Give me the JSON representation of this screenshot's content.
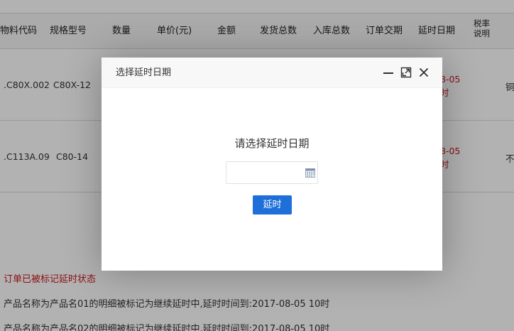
{
  "table": {
    "headers": [
      "物料代码",
      "规格型号",
      "数量",
      "单价(元)",
      "金额",
      "发货总数",
      "入库总数",
      "订单交期",
      "延时日期"
    ],
    "tax_header": "税率说明",
    "rows": [
      {
        "material_code": ".C80X.002",
        "spec": "C80X-12",
        "delay_date": "8-05",
        "delay_time": "时",
        "tax_note": "铜"
      },
      {
        "material_code": ".C113A.09",
        "spec": "C80-14",
        "delay_date": "8-05",
        "delay_time": "时",
        "tax_note": "不"
      }
    ]
  },
  "messages": {
    "status": "订单已被标记延时状态",
    "lines": [
      "产品名称为产品名01的明细被标记为继续延时中,延时时间到:2017-08-05 10时",
      "产品名称为产品名02的明细被标记为继续延时中,延时时间到:2017-08-05 10时"
    ]
  },
  "dialog": {
    "title": "选择延时日期",
    "prompt": "请选择延时日期",
    "date_value": "",
    "date_placeholder": "",
    "confirm_label": "延时",
    "icons": [
      "minimize-icon",
      "maximize-icon",
      "close-icon",
      "calendar-icon"
    ]
  },
  "colors": {
    "accent": "#1e6fd9",
    "warning_text": "#c8161d",
    "overlay": "rgba(0,0,0,0.3)"
  }
}
